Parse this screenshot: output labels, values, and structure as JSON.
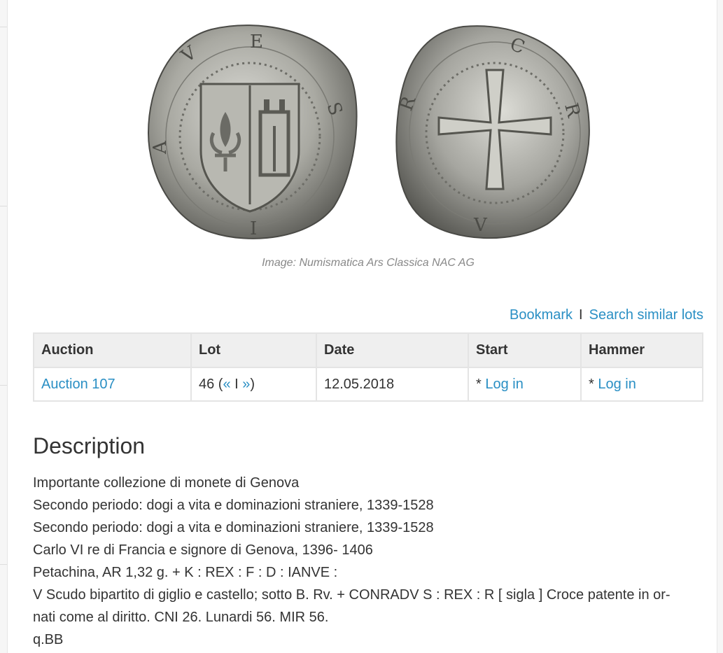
{
  "image": {
    "caption": "Image: Numismatica Ars Classica NAC AG"
  },
  "actions": {
    "bookmark": "Bookmark",
    "separator": "I",
    "search_similar": "Search similar lots"
  },
  "table": {
    "headers": [
      "Auction",
      "Lot",
      "Date",
      "Start",
      "Hammer"
    ],
    "row": {
      "auction": "Auction 107",
      "lot_number": "46 (",
      "lot_prev": "«",
      "lot_sep": " I ",
      "lot_next": "»",
      "lot_close": ")",
      "date": "12.05.2018",
      "start_prefix": "* ",
      "start_link": "Log in",
      "hammer_prefix": "* ",
      "hammer_link": "Log in"
    }
  },
  "description": {
    "title": "Description",
    "lines": [
      "Importante collezione di monete di Genova",
      "Secondo periodo: dogi a vita e dominazioni straniere, 1339-1528",
      "Secondo periodo: dogi a vita e dominazioni straniere, 1339-1528",
      "Carlo VI re di Francia e signore di Genova, 1396- 1406",
      "Petachina, AR 1,32 g. + K : REX : F : D : IANVE :",
      "V Scudo bipartito di giglio e castello; sotto B. Rv. + CONRADV S : REX : R [ sigla ] Croce patente in or-",
      "nati come al diritto. CNI 26. Lunardi 56. MIR 56.",
      "q.BB"
    ]
  }
}
